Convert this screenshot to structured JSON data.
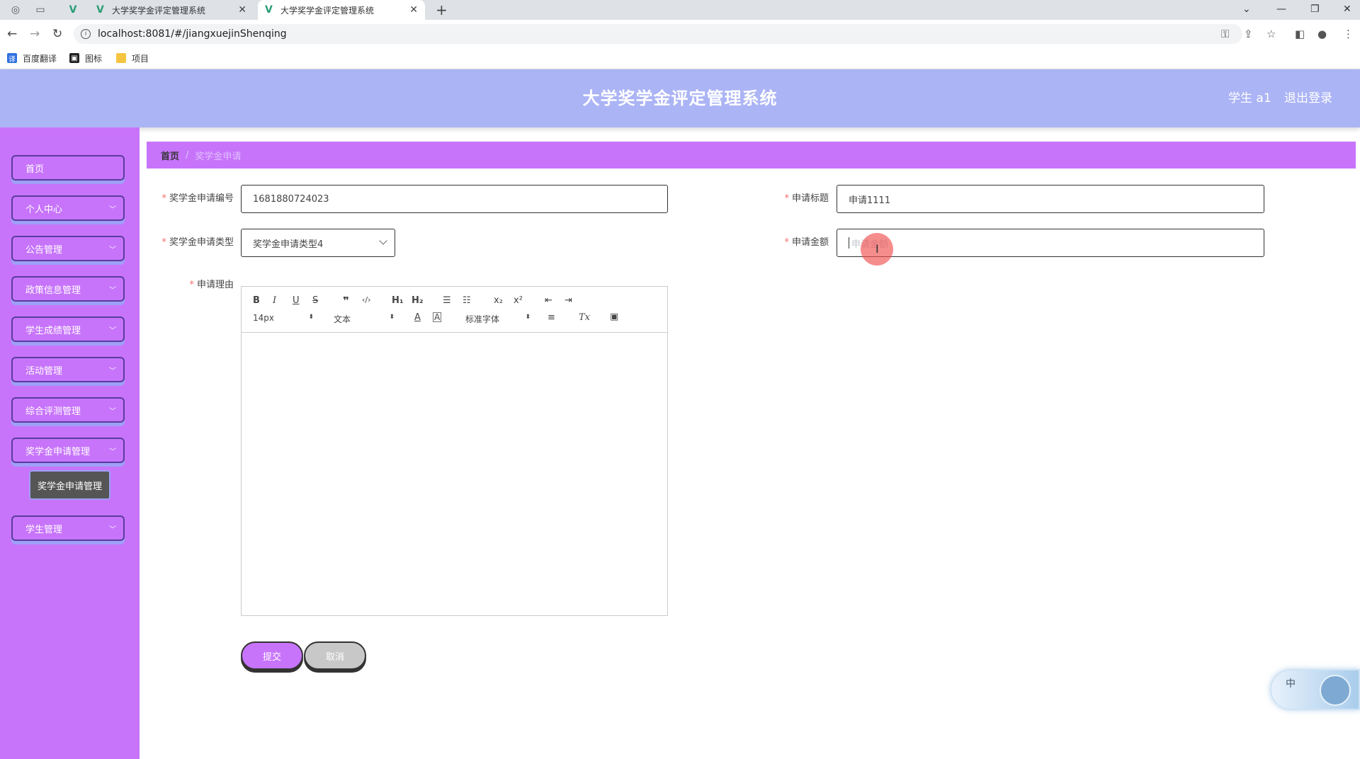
{
  "browser": {
    "tabs": [
      {
        "title": "大学奖学金评定管理系统",
        "active": false
      },
      {
        "title": "大学奖学金评定管理系统",
        "active": true
      }
    ],
    "url": "localhost:8081/#/jiangxuejinShenqing",
    "bookmarks": [
      "百度翻译",
      "图标",
      "项目"
    ]
  },
  "header": {
    "title": "大学奖学金评定管理系统",
    "user": "学生 a1",
    "logout": "退出登录"
  },
  "sidebar": {
    "items": [
      {
        "label": "首页",
        "has_children": false
      },
      {
        "label": "个人中心",
        "has_children": true
      },
      {
        "label": "公告管理",
        "has_children": true
      },
      {
        "label": "政策信息管理",
        "has_children": true
      },
      {
        "label": "学生成绩管理",
        "has_children": true
      },
      {
        "label": "活动管理",
        "has_children": true
      },
      {
        "label": "综合评测管理",
        "has_children": true
      },
      {
        "label": "奖学金申请管理",
        "has_children": true
      },
      {
        "label": "学生管理",
        "has_children": true
      }
    ],
    "submenu": {
      "label": "奖学金申请管理"
    }
  },
  "breadcrumb": {
    "home": "首页",
    "separator": "/",
    "current": "奖学金申请"
  },
  "form": {
    "number": {
      "label": "奖学金申请编号",
      "value": "1681880724023"
    },
    "title": {
      "label": "申请标题",
      "value": "申请1111"
    },
    "type": {
      "label": "奖学金申请类型",
      "value": "奖学金申请类型4"
    },
    "amount": {
      "label": "申请金额",
      "placeholder": "申请金额"
    },
    "reason": {
      "label": "申请理由"
    },
    "editor": {
      "font_size": "14px",
      "block_type": "文本",
      "font_family": "标准字体"
    },
    "submit": "提交",
    "cancel": "取消"
  },
  "widget": {
    "text": "中"
  },
  "colors": {
    "header_bg": "#abb4f5",
    "sidebar_bg": "#c774fb",
    "accent": "#c774fb",
    "required": "#f56c6c"
  }
}
